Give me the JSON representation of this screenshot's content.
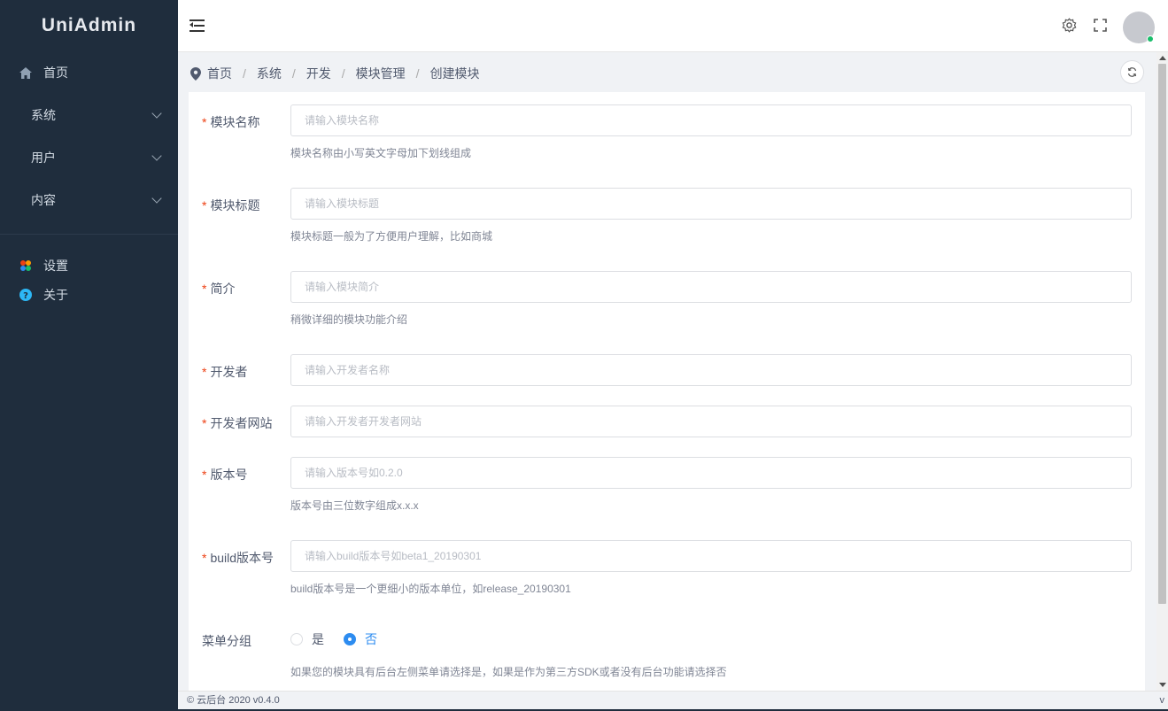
{
  "app": {
    "title": "UniAdmin"
  },
  "sidebar": {
    "items": [
      {
        "label": "首页",
        "icon": "home-icon"
      },
      {
        "label": "系统",
        "icon": "chevron-down-icon"
      },
      {
        "label": "用户",
        "icon": "chevron-down-icon"
      },
      {
        "label": "内容",
        "icon": "chevron-down-icon"
      }
    ],
    "extra": [
      {
        "label": "设置",
        "icon": "palette-icon"
      },
      {
        "label": "关于",
        "icon": "help-icon"
      }
    ]
  },
  "header": {
    "icons": [
      "menu-fold-icon",
      "gear-icon",
      "fullscreen-icon",
      "avatar"
    ]
  },
  "breadcrumb": [
    "首页",
    "系统",
    "开发",
    "模块管理",
    "创建模块"
  ],
  "form": {
    "name": {
      "label": "模块名称",
      "placeholder": "请输入模块名称",
      "help": "模块名称由小写英文字母加下划线组成"
    },
    "title": {
      "label": "模块标题",
      "placeholder": "请输入模块标题",
      "help": "模块标题一般为了方便用户理解，比如商城"
    },
    "desc": {
      "label": "简介",
      "placeholder": "请输入模块简介",
      "help": "稍微详细的模块功能介绍"
    },
    "author": {
      "label": "开发者",
      "placeholder": "请输入开发者名称"
    },
    "site": {
      "label": "开发者网站",
      "placeholder": "请输入开发者开发者网站"
    },
    "version": {
      "label": "版本号",
      "placeholder": "请输入版本号如0.2.0",
      "help": "版本号由三位数字组成x.x.x"
    },
    "build": {
      "label": "build版本号",
      "placeholder": "请输入build版本号如beta1_20190301",
      "help": "build版本号是一个更细小的版本单位，如release_20190301"
    },
    "menu": {
      "label": "菜单分组",
      "options": [
        "是",
        "否"
      ],
      "selected": "否",
      "help": "如果您的模块具有后台左侧菜单请选择是，如果是作为第三方SDK或者没有后台功能请选择否"
    }
  },
  "footer": {
    "copyright": "© 云后台 2020 v0.4.0",
    "right": "v"
  },
  "colors": {
    "sidebar": "#1f2d3d",
    "primary": "#2d8cf0",
    "required": "#ed4014"
  }
}
